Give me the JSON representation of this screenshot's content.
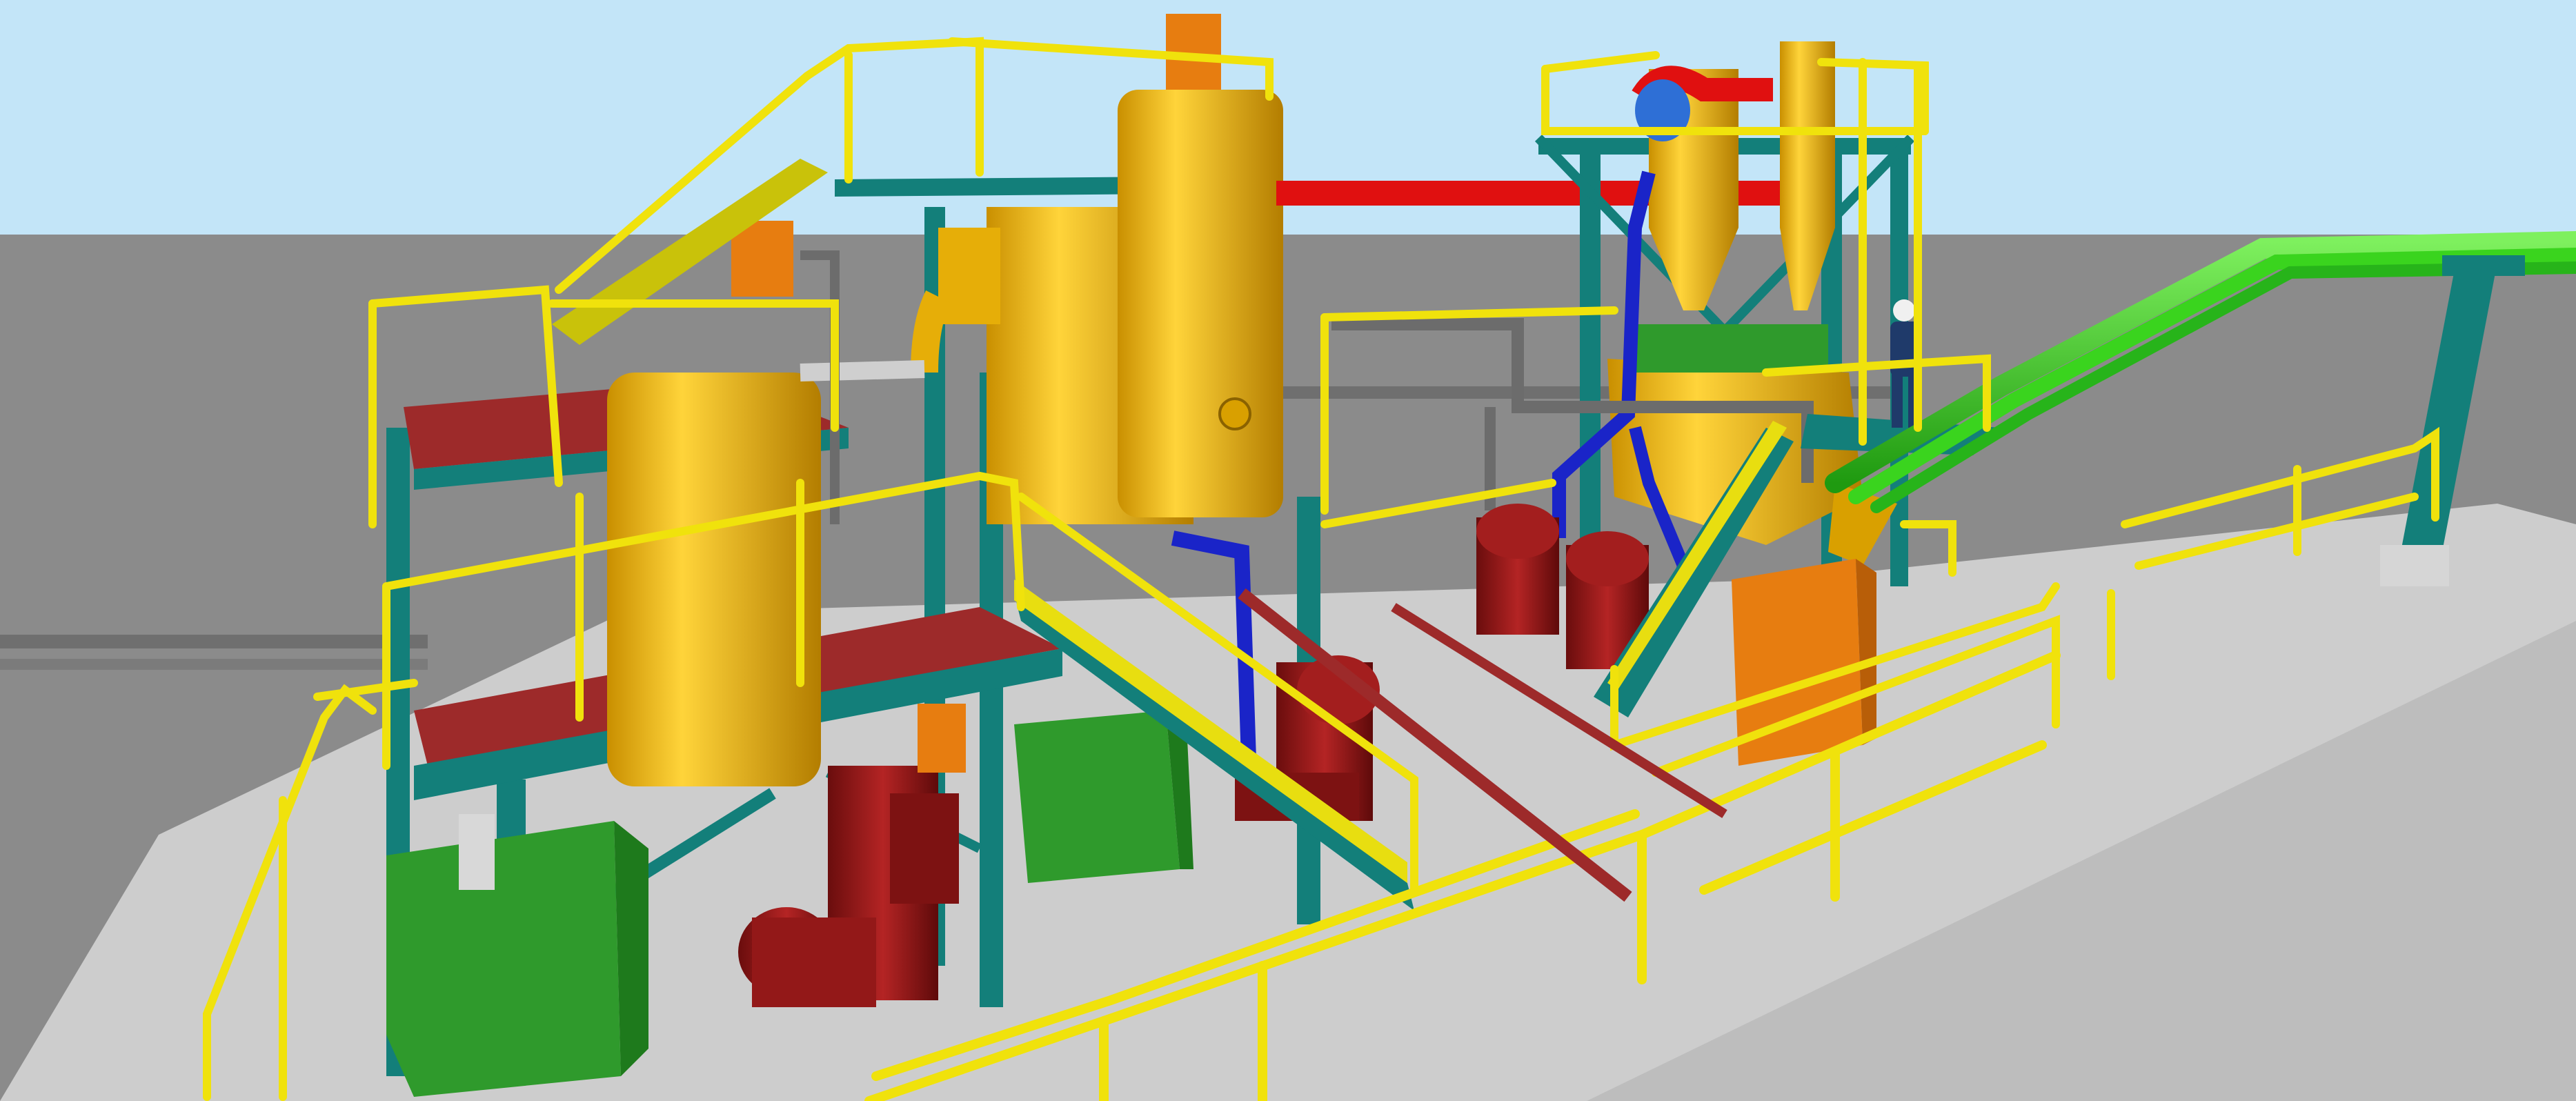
{
  "scene": {
    "subject": "industrial-plant-3d-model",
    "colors": {
      "sky": "#c3e5f8",
      "ground": "#8a8a8a",
      "slab": "#cfcfcf",
      "steel": "#137f7a",
      "railing": "#f0e20c",
      "deck": "#9d2a2a",
      "vessel": "#e9b20c",
      "pump": "#8a1515",
      "hopper": "#2f9a2c",
      "red_pipe": "#e01010",
      "green_pipe": "#3ad41e",
      "blue_pipe": "#1a24c8",
      "orange_box": "#e77d10",
      "grey_pipe": "#6c6c6c"
    }
  }
}
